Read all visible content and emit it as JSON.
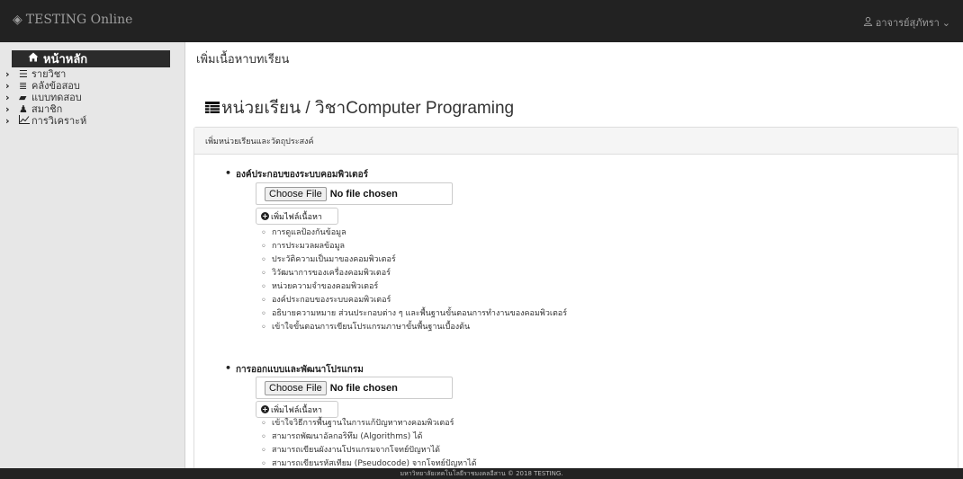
{
  "topbar": {
    "brand_icon": "layers-icon",
    "brand": "TESTING Online",
    "user_icon": "user-icon",
    "user_name": "อาจารย์สุภัทรา",
    "user_caret": "⌄"
  },
  "sidebar": {
    "home": {
      "icon": "home-icon",
      "label": "หน้าหลัก"
    },
    "items": [
      {
        "label": "รายวิชา",
        "icon": "list-icon"
      },
      {
        "label": "คลังข้อสอบ",
        "icon": "database-icon"
      },
      {
        "label": "แบบทดสอบ",
        "icon": "book-icon"
      },
      {
        "label": "สมาชิก",
        "icon": "users-icon"
      },
      {
        "label": "การวิเคราะห์",
        "icon": "chart-icon"
      }
    ]
  },
  "main": {
    "heading": "เพิ่มเนื้อหาบทเรียน",
    "course_icon": "table-icon",
    "course_title": "หน่วยเรียน / วิชาComputer Programing",
    "panel_title": "เพิ่มหน่วยเรียนและวัตถุประสงค์",
    "file_button": "Choose File",
    "file_status": "No file chosen",
    "add_button": "เพิ่มไฟล์เนื้อหา",
    "units": [
      {
        "title": "องค์ประกอบของระบบคอมพิวเตอร์",
        "topics": [
          "การดูแลป้องกันข้อมูล",
          "การประมวลผลข้อมูล",
          "ประวัติความเป็นมาของคอมพิวเตอร์",
          "วิวัฒนาการของเครื่องคอมพิวเตอร์",
          "หน่วยความจำของคอมพิวเตอร์",
          "องค์ประกอบของระบบคอมพิวเตอร์",
          "อธิบายความหมาย ส่วนประกอบต่าง ๆ และพื้นฐานขั้นตอนการทำงานของคอมพิวเตอร์",
          "เข้าใจขั้นตอนการเขียนโปรแกรมภาษาขั้นพื้นฐานเบื้องต้น"
        ]
      },
      {
        "title": "การออกแบบและพัฒนาโปรแกรม",
        "topics": [
          "เข้าใจวิธีการพื้นฐานในการแก้ปัญหาทางคอมพิวเตอร์",
          "สามารถพัฒนาอัลกอริทึม (Algorithms) ได้",
          "สามารถเขียนผังงานโปรแกรมจากโจทย์ปัญหาได้",
          "สามารถเขียนรหัสเทียม (Pseudocode) จากโจทย์ปัญหาได้"
        ]
      }
    ]
  },
  "footer": {
    "text": "มหาวิทยาลัยเทคโนโลยีราชมงคลอีสาน © 2018 TESTING."
  }
}
